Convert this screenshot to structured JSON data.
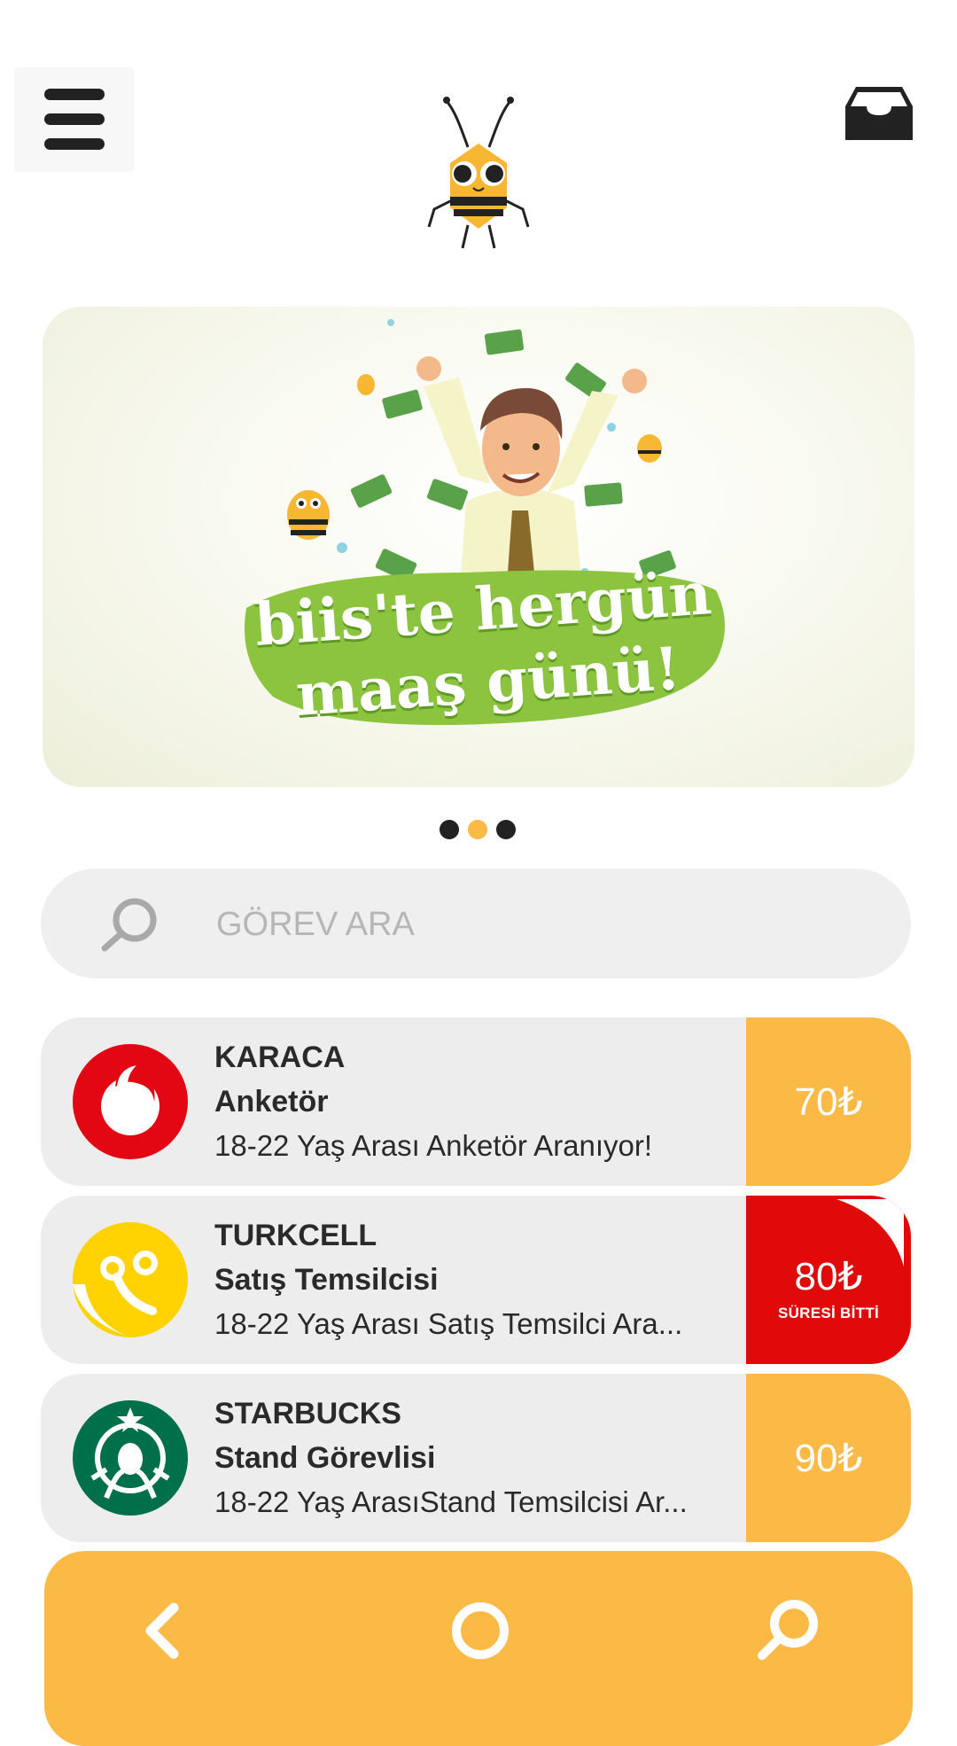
{
  "header": {
    "menu_icon": "hamburger-menu-icon",
    "logo_icon": "bee-logo-icon",
    "inbox_icon": "inbox-tray-icon"
  },
  "banner": {
    "line1": "biis'te hergün",
    "line2": "maaş günü!",
    "carousel": {
      "count": 3,
      "active_index": 1
    }
  },
  "search": {
    "placeholder": "GÖREV ARA",
    "value": "",
    "icon": "search-icon"
  },
  "tasks": [
    {
      "company": "KARACA",
      "role": "Anketör",
      "description": "18-22 Yaş Arası Anketör Aranıyor!",
      "price": "70₺",
      "status": "",
      "logo": "vodafone-logo"
    },
    {
      "company": "TURKCELL",
      "role": "Satış Temsilcisi",
      "description": "18-22 Yaş Arası Satış Temsilci Ara...",
      "price": "80₺",
      "status": "SÜRESİ BİTTİ",
      "logo": "turkcell-logo"
    },
    {
      "company": "STARBUCKS",
      "role": "Stand Görevlisi",
      "description": "18-22 Yaş ArasıStand Temsilcisi Ar...",
      "price": "90₺",
      "status": "",
      "logo": "starbucks-logo"
    }
  ],
  "bottom_nav": {
    "items": [
      "back-chevron-icon",
      "home-circle-icon",
      "search-icon"
    ]
  },
  "colors": {
    "accent": "#fbb945",
    "expired": "#e10a0a",
    "card_bg": "#ededed",
    "dark": "#222222",
    "banner_green": "#8cc43f"
  }
}
